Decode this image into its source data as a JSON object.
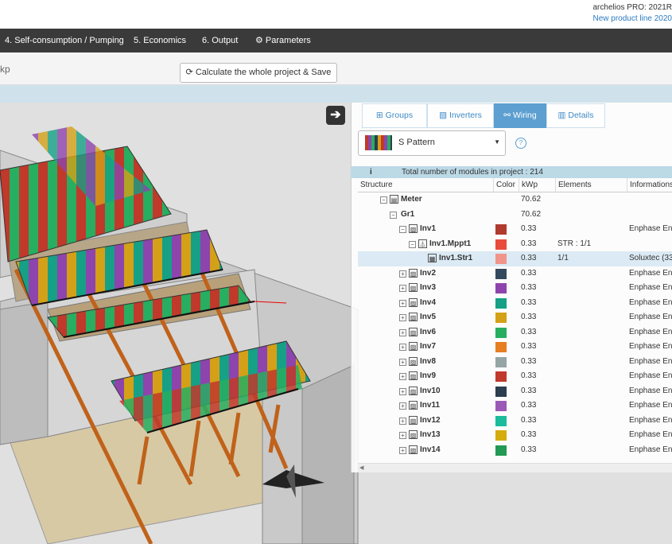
{
  "brand": {
    "line1": "archelios PRO: 2021R",
    "line2": "New product line 2020"
  },
  "nav": [
    "4. Self-consumption / Pumping",
    "5. Economics",
    "6. Output",
    "Parameters"
  ],
  "toolbar": {
    "left_text": "kp",
    "calc_label": "Calculate the whole project & Save"
  },
  "tabs": [
    "Groups",
    "Inverters",
    "Wiring",
    "Details"
  ],
  "active_tab": "Wiring",
  "pattern": {
    "label": "S Pattern"
  },
  "total": "Total number of modules in project : 214",
  "columns": [
    "Structure",
    "Color",
    "kWp",
    "Elements",
    "Informations"
  ],
  "rows": [
    {
      "indent": 0,
      "toggle": "⊟",
      "icon": "meter",
      "name": "Meter",
      "color": "",
      "kwp": "70.62",
      "elements": "",
      "info": "",
      "bold": true
    },
    {
      "indent": 1,
      "toggle": "⊟",
      "icon": "",
      "name": "Gr1",
      "color": "",
      "kwp": "70.62",
      "elements": "",
      "info": "",
      "bold": true
    },
    {
      "indent": 2,
      "toggle": "⊟",
      "icon": "inverter",
      "name": "Inv1",
      "color": "#b03a2e",
      "kwp": "0.33",
      "elements": "",
      "info": "Enphase Ene",
      "bold": true
    },
    {
      "indent": 3,
      "toggle": "⊟",
      "icon": "mppt",
      "name": "Inv1.Mppt1",
      "color": "#e74c3c",
      "kwp": "0.33",
      "elements": "STR : 1/1",
      "info": "",
      "bold": true
    },
    {
      "indent": 4,
      "toggle": "",
      "icon": "string",
      "name": "Inv1.Str1",
      "color": "#f1948a",
      "kwp": "0.33",
      "elements": "1/1",
      "info": "Soluxtec (33",
      "bold": true,
      "selected": true
    },
    {
      "indent": 2,
      "toggle": "⊞",
      "icon": "inverter",
      "name": "Inv2",
      "color": "#34495e",
      "kwp": "0.33",
      "elements": "",
      "info": "Enphase Ene",
      "bold": true
    },
    {
      "indent": 2,
      "toggle": "⊞",
      "icon": "inverter",
      "name": "Inv3",
      "color": "#8e44ad",
      "kwp": "0.33",
      "elements": "",
      "info": "Enphase Ene",
      "bold": true
    },
    {
      "indent": 2,
      "toggle": "⊞",
      "icon": "inverter",
      "name": "Inv4",
      "color": "#16a085",
      "kwp": "0.33",
      "elements": "",
      "info": "Enphase Ene",
      "bold": true
    },
    {
      "indent": 2,
      "toggle": "⊞",
      "icon": "inverter",
      "name": "Inv5",
      "color": "#d4a017",
      "kwp": "0.33",
      "elements": "",
      "info": "Enphase Ene",
      "bold": true
    },
    {
      "indent": 2,
      "toggle": "⊞",
      "icon": "inverter",
      "name": "Inv6",
      "color": "#27ae60",
      "kwp": "0.33",
      "elements": "",
      "info": "Enphase Ene",
      "bold": true
    },
    {
      "indent": 2,
      "toggle": "⊞",
      "icon": "inverter",
      "name": "Inv7",
      "color": "#e67e22",
      "kwp": "0.33",
      "elements": "",
      "info": "Enphase Ene",
      "bold": true
    },
    {
      "indent": 2,
      "toggle": "⊞",
      "icon": "inverter",
      "name": "Inv8",
      "color": "#95a5a6",
      "kwp": "0.33",
      "elements": "",
      "info": "Enphase Ene",
      "bold": true
    },
    {
      "indent": 2,
      "toggle": "⊞",
      "icon": "inverter",
      "name": "Inv9",
      "color": "#c0392b",
      "kwp": "0.33",
      "elements": "",
      "info": "Enphase Ene",
      "bold": true
    },
    {
      "indent": 2,
      "toggle": "⊞",
      "icon": "inverter",
      "name": "Inv10",
      "color": "#2c3e50",
      "kwp": "0.33",
      "elements": "",
      "info": "Enphase Ene",
      "bold": true
    },
    {
      "indent": 2,
      "toggle": "⊞",
      "icon": "inverter",
      "name": "Inv11",
      "color": "#9b59b6",
      "kwp": "0.33",
      "elements": "",
      "info": "Enphase Ene",
      "bold": true
    },
    {
      "indent": 2,
      "toggle": "⊞",
      "icon": "inverter",
      "name": "Inv12",
      "color": "#1abc9c",
      "kwp": "0.33",
      "elements": "",
      "info": "Enphase Ene",
      "bold": true
    },
    {
      "indent": 2,
      "toggle": "⊞",
      "icon": "inverter",
      "name": "Inv13",
      "color": "#d4ac0d",
      "kwp": "0.33",
      "elements": "",
      "info": "Enphase Ene",
      "bold": true
    },
    {
      "indent": 2,
      "toggle": "⊞",
      "icon": "inverter",
      "name": "Inv14",
      "color": "#229954",
      "kwp": "0.33",
      "elements": "",
      "info": "Enphase Ene",
      "bold": true
    }
  ]
}
